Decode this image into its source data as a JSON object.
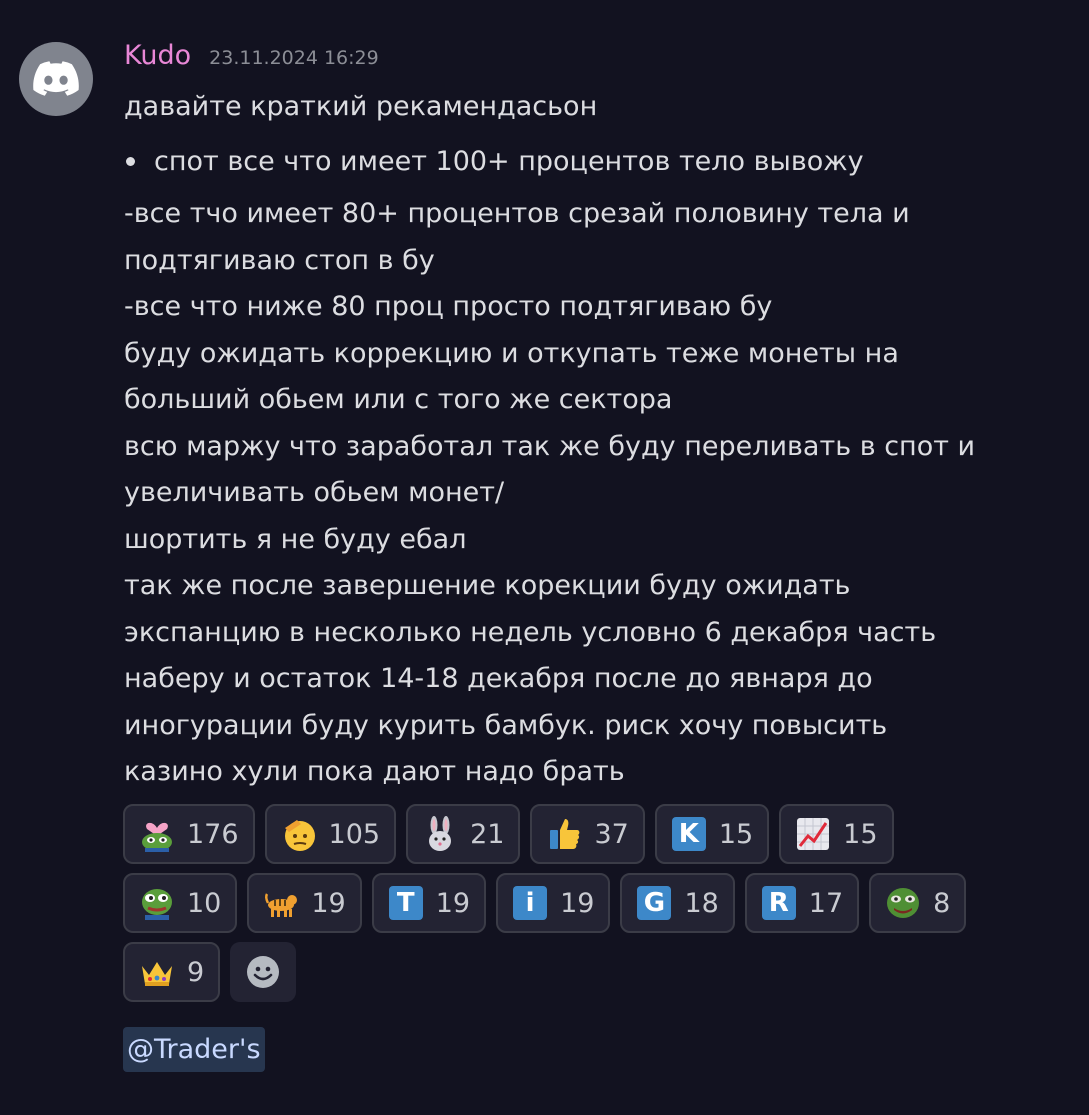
{
  "message": {
    "username": "Kudo",
    "timestamp": "23.11.2024 16:29",
    "first_line": "давайте краткий рекамендасьон",
    "bullet": "спот все что имеет 100+ процентов тело вывожу",
    "lines": [
      "-все тчо имеет 80+ процентов срезай половину тела и",
      "подтягиваю стоп в бу",
      "-все что ниже 80 проц просто подтягиваю бу",
      "буду ожидать коррекцию и откупать теже монеты на",
      "больший обьем или с того же сектора",
      "всю маржу что заработал так же буду переливать в спот и",
      "увеличивать обьем монет/",
      "шортить я не буду ебал",
      "так же после завершение корекции буду ожидать",
      "экспанцию в несколько недель условно 6 декабря часть",
      "наберу и остаток 14-18 декабря после до явнаря до",
      "иногурации буду курить бамбук. риск хочу повысить",
      "казино хули пока дают надо брать"
    ],
    "mention": "@Trader's"
  },
  "reactions": [
    {
      "icon": "pepe-heart-emoji",
      "count": "176"
    },
    {
      "icon": "saluting-face-emoji",
      "count": "105"
    },
    {
      "icon": "rabbit-face-emoji",
      "count": "21"
    },
    {
      "icon": "thumbs-up-emoji",
      "count": "37"
    },
    {
      "icon": "letter-k-emoji",
      "letter": "K",
      "count": "15"
    },
    {
      "icon": "chart-increasing-emoji",
      "count": "15"
    },
    {
      "icon": "pepe-frog-emoji",
      "count": "10"
    },
    {
      "icon": "tiger-emoji",
      "count": "19"
    },
    {
      "icon": "letter-t-emoji",
      "letter": "T",
      "count": "19"
    },
    {
      "icon": "letter-i-emoji",
      "letter": "i",
      "count": "19"
    },
    {
      "icon": "letter-g-emoji",
      "letter": "G",
      "count": "18"
    },
    {
      "icon": "letter-r-emoji",
      "letter": "R",
      "count": "17"
    },
    {
      "icon": "pepe-smile-emoji",
      "count": "8"
    },
    {
      "icon": "crown-emoji",
      "count": "9"
    }
  ],
  "colors": {
    "background": "#121220",
    "username": "#e887d6",
    "text": "#dcdde1",
    "reaction_bg": "#232333",
    "mention_bg": "#27364f",
    "letter_tile": "#3d88c9"
  }
}
